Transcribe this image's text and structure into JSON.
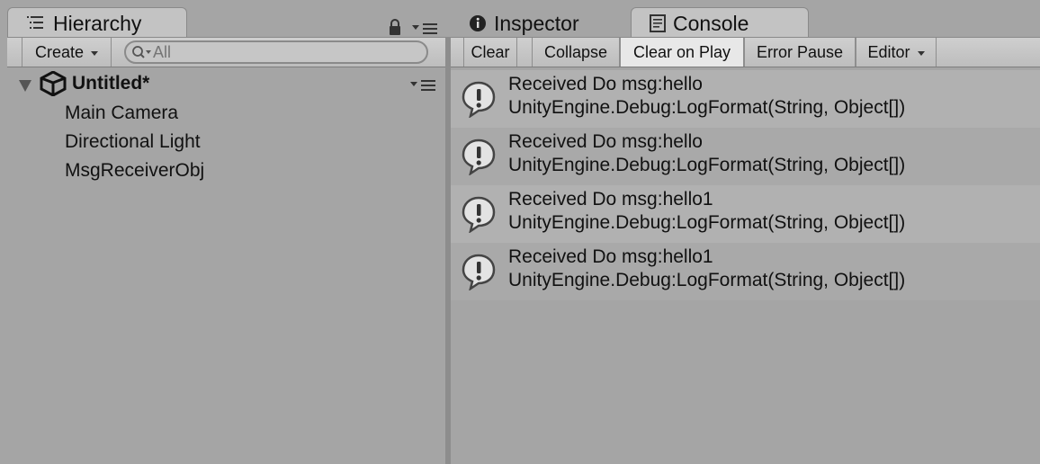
{
  "tabs": {
    "hierarchy": "Hierarchy",
    "inspector": "Inspector",
    "console": "Console"
  },
  "hierarchy": {
    "create_label": "Create",
    "search_placeholder": "All",
    "scene_name": "Untitled*",
    "items": [
      "Main Camera",
      "Directional Light",
      "MsgReceiverObj"
    ]
  },
  "console": {
    "toolbar": {
      "clear": "Clear",
      "collapse": "Collapse",
      "clear_on_play": "Clear on Play",
      "error_pause": "Error Pause",
      "editor": "Editor"
    },
    "logs": [
      {
        "message": "Received Do msg:hello",
        "stack": "UnityEngine.Debug:LogFormat(String, Object[])"
      },
      {
        "message": "Received Do msg:hello",
        "stack": "UnityEngine.Debug:LogFormat(String, Object[])"
      },
      {
        "message": "Received Do msg:hello1",
        "stack": "UnityEngine.Debug:LogFormat(String, Object[])"
      },
      {
        "message": "Received Do msg:hello1",
        "stack": "UnityEngine.Debug:LogFormat(String, Object[])"
      }
    ]
  },
  "colors": {
    "background": "#a5a5a5",
    "toolbar": "#c4c4c4",
    "active_toggle": "#e8e8e8"
  }
}
